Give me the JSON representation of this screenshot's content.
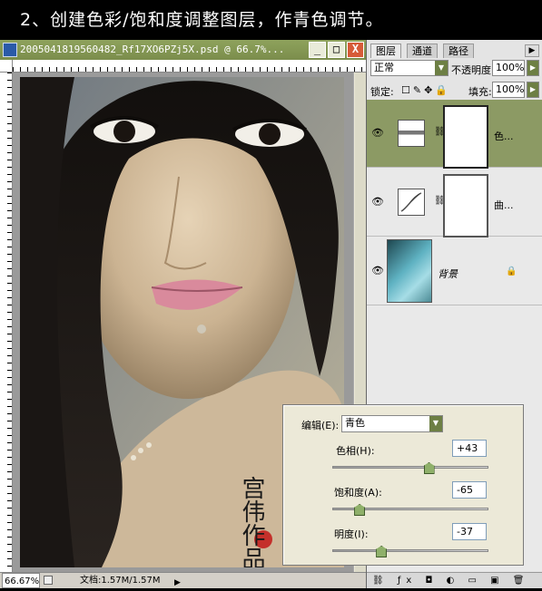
{
  "banner": {
    "text": "2、创建色彩/饱和度调整图层，作青色调节。"
  },
  "document": {
    "title": "2005041819560482_Rf17XO6PZj5X.psd @ 66.7%...",
    "window_buttons": {
      "minimize": "_",
      "maximize": "□",
      "close": "X"
    },
    "status": {
      "zoom": "66.67%",
      "doc_info": "文档:1.57M/1.57M"
    },
    "watermark": "宫伟作品"
  },
  "layers_panel": {
    "tabs": [
      "图层",
      "通道",
      "路径"
    ],
    "blend_mode": "正常",
    "opacity_label": "不透明度:",
    "opacity_value": "100%",
    "lock_label": "锁定:",
    "fill_label": "填充:",
    "fill_value": "100%",
    "layers": [
      {
        "name": "色...",
        "type": "hue-saturation-adjustment",
        "selected": true
      },
      {
        "name": "曲...",
        "type": "curves-adjustment",
        "selected": false
      },
      {
        "name": "背景",
        "type": "background",
        "selected": false
      }
    ]
  },
  "hue_sat_dialog": {
    "edit_label": "编辑(E):",
    "edit_value": "青色",
    "hue_label": "色相(H):",
    "hue_value": "+43",
    "hue_level": 43,
    "saturation_label": "饱和度(A):",
    "saturation_value": "-65",
    "saturation_level": -65,
    "lightness_label": "明度(I):",
    "lightness_value": "-37",
    "lightness_level": -37
  },
  "colors": {
    "titlebar": "#8ea25c",
    "selected_layer": "#8c9a64",
    "slider_thumb": "#8fb06a"
  }
}
